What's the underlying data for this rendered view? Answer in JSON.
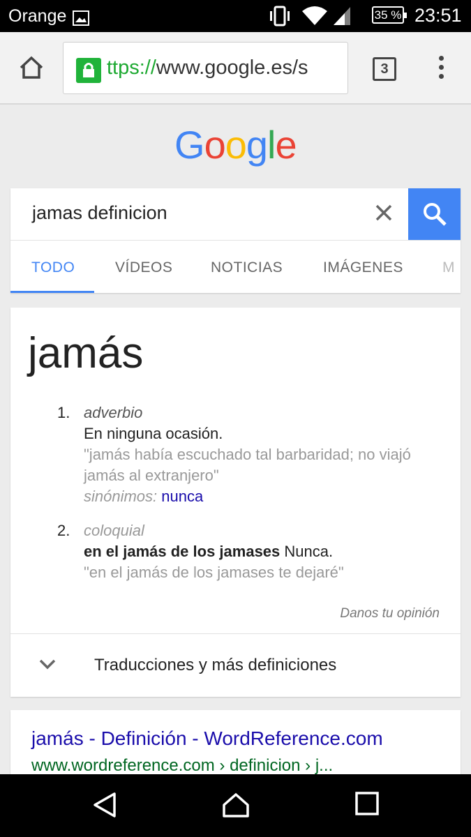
{
  "status_bar": {
    "carrier": "Orange",
    "battery": "35 %",
    "time": "23:51",
    "icons": [
      "gallery-icon",
      "vibrate-icon",
      "wifi-icon",
      "signal-icon",
      "battery-icon"
    ]
  },
  "browser": {
    "url_scheme": "ttps://",
    "url_host": "www.google.es/s",
    "tab_count": "3",
    "icons": [
      "home-icon",
      "lock-icon",
      "tabs-icon",
      "overflow-menu-icon"
    ]
  },
  "search": {
    "query": "jamas definicion",
    "tabs": [
      "TODO",
      "VÍDEOS",
      "NOTICIAS",
      "IMÁGENES",
      "M"
    ],
    "active_tab": "TODO",
    "accent_color": "#4285f4"
  },
  "definition": {
    "headword": "jamás",
    "senses": [
      {
        "number": "1.",
        "label": "adverbio",
        "gloss": "En ninguna ocasión.",
        "example_lines": [
          "\"jamás había escuchado tal barbaridad; no viajó",
          "jamás al extranjero\""
        ],
        "synonyms_label": "sinónimos:",
        "synonym": "nunca"
      },
      {
        "number": "2.",
        "label": "coloquial",
        "phrase": "en el jamás de los jamases",
        "gloss": "Nunca.",
        "example": "\"en el jamás de los jamases te dejaré\""
      }
    ],
    "feedback": "Danos tu opinión",
    "more": "Traducciones y más definiciones"
  },
  "result": {
    "title": "jamás - Definición - WordReference.com",
    "url": "www.wordreference.com › definicion › j..."
  },
  "colors": {
    "link": "#1a0dab",
    "url_green": "#006621",
    "lock_green": "#20b33a"
  }
}
